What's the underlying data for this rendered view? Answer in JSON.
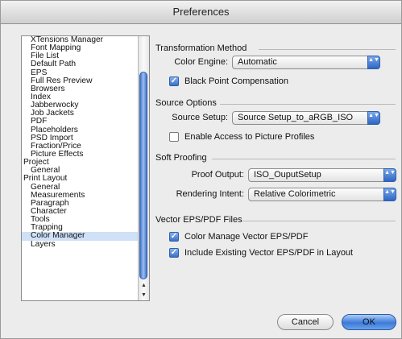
{
  "window": {
    "title": "Preferences"
  },
  "list": {
    "items": [
      {
        "label": "XTensions Manager",
        "level": "sub",
        "selected": false
      },
      {
        "label": "Font Mapping",
        "level": "sub",
        "selected": false
      },
      {
        "label": "File List",
        "level": "sub",
        "selected": false
      },
      {
        "label": "Default Path",
        "level": "sub",
        "selected": false
      },
      {
        "label": "EPS",
        "level": "sub",
        "selected": false
      },
      {
        "label": "Full Res Preview",
        "level": "sub",
        "selected": false
      },
      {
        "label": "Browsers",
        "level": "sub",
        "selected": false
      },
      {
        "label": "Index",
        "level": "sub",
        "selected": false
      },
      {
        "label": "Jabberwocky",
        "level": "sub",
        "selected": false
      },
      {
        "label": "Job Jackets",
        "level": "sub",
        "selected": false
      },
      {
        "label": "PDF",
        "level": "sub",
        "selected": false
      },
      {
        "label": "Placeholders",
        "level": "sub",
        "selected": false
      },
      {
        "label": "PSD Import",
        "level": "sub",
        "selected": false
      },
      {
        "label": "Fraction/Price",
        "level": "sub",
        "selected": false
      },
      {
        "label": "Picture Effects",
        "level": "sub",
        "selected": false
      },
      {
        "label": "Project",
        "level": "top",
        "selected": false
      },
      {
        "label": "General",
        "level": "sub",
        "selected": false
      },
      {
        "label": "Print Layout",
        "level": "top",
        "selected": false
      },
      {
        "label": "General",
        "level": "sub",
        "selected": false
      },
      {
        "label": "Measurements",
        "level": "sub",
        "selected": false
      },
      {
        "label": "Paragraph",
        "level": "sub",
        "selected": false
      },
      {
        "label": "Character",
        "level": "sub",
        "selected": false
      },
      {
        "label": "Tools",
        "level": "sub",
        "selected": false
      },
      {
        "label": "Trapping",
        "level": "sub",
        "selected": false
      },
      {
        "label": "Color Manager",
        "level": "sub",
        "selected": true
      },
      {
        "label": "Layers",
        "level": "sub",
        "selected": false
      }
    ]
  },
  "transformation": {
    "heading": "Transformation Method",
    "color_engine_label": "Color Engine:",
    "color_engine_value": "Automatic",
    "black_point_label": "Black Point Compensation",
    "black_point_checked": true
  },
  "source": {
    "heading": "Source Options",
    "source_setup_label": "Source Setup:",
    "source_setup_value": "Source Setup_to_aRGB_ISO",
    "enable_access_label": "Enable Access to Picture Profiles",
    "enable_access_checked": false
  },
  "soft_proofing": {
    "heading": "Soft Proofing",
    "proof_output_label": "Proof Output:",
    "proof_output_value": "ISO_OuputSetup",
    "rendering_intent_label": "Rendering Intent:",
    "rendering_intent_value": "Relative Colorimetric"
  },
  "vector": {
    "heading": "Vector EPS/PDF Files",
    "color_manage_label": "Color Manage Vector EPS/PDF",
    "color_manage_checked": true,
    "include_existing_label": "Include Existing Vector EPS/PDF in Layout",
    "include_existing_checked": true
  },
  "buttons": {
    "cancel": "Cancel",
    "ok": "OK"
  },
  "glyphs": {
    "check": "✓",
    "arrows_updown": "▲▼",
    "scroll_up": "▲",
    "scroll_down": "▼"
  }
}
